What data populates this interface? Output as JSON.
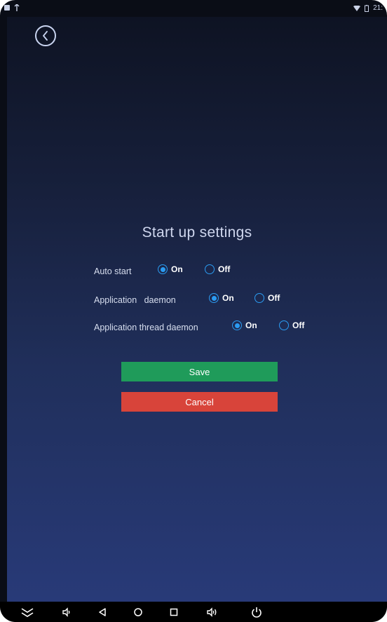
{
  "status_bar": {
    "time": "21:"
  },
  "page": {
    "title": "Start up settings"
  },
  "settings": [
    {
      "label": "Auto start",
      "on_label": "On",
      "off_label": "Off",
      "selected": "on"
    },
    {
      "label": "Application   daemon",
      "on_label": "On",
      "off_label": "Off",
      "selected": "on"
    },
    {
      "label": "Application thread daemon",
      "on_label": "On",
      "off_label": "Off",
      "selected": "on"
    }
  ],
  "buttons": {
    "save": "Save",
    "cancel": "Cancel"
  },
  "colors": {
    "accent": "#2b9cf2",
    "save": "#1f9b5a",
    "cancel": "#d8443a",
    "background_top": "#0e1323",
    "background_bottom": "#283a78"
  },
  "icons": {
    "back": "back-circle-icon",
    "nav": [
      "collapse-chevrons-icon",
      "volume-down-icon",
      "back-triangle-icon",
      "home-circle-icon",
      "recents-square-icon",
      "volume-up-icon",
      "power-icon"
    ]
  }
}
